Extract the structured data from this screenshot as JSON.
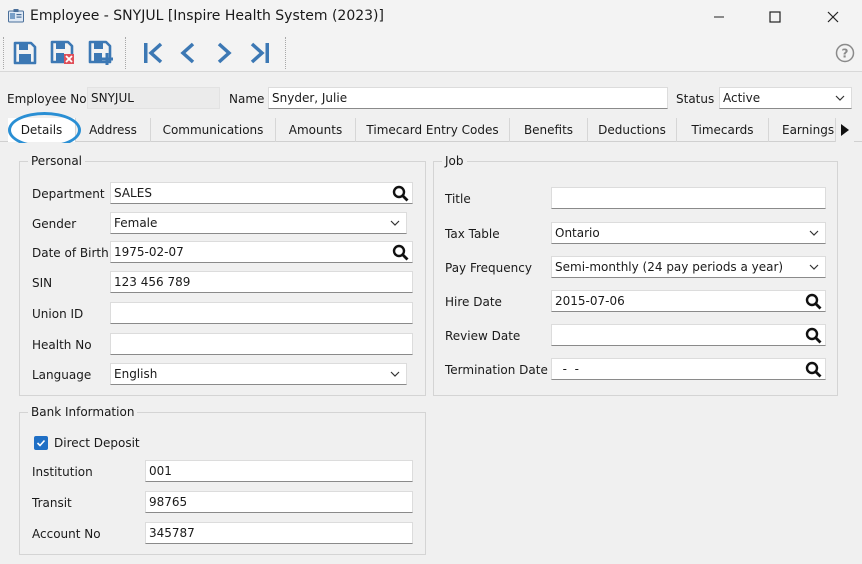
{
  "window": {
    "title": "Employee - SNYJUL [Inspire Health System (2023)]"
  },
  "header": {
    "employee_no_label": "Employee No",
    "employee_no_value": "SNYJUL",
    "name_label": "Name",
    "name_value": "Snyder, Julie",
    "status_label": "Status",
    "status_value": "Active"
  },
  "tabs": [
    {
      "label": "Details",
      "active": true
    },
    {
      "label": "Address"
    },
    {
      "label": "Communications"
    },
    {
      "label": "Amounts"
    },
    {
      "label": "Timecard Entry Codes"
    },
    {
      "label": "Benefits"
    },
    {
      "label": "Deductions"
    },
    {
      "label": "Timecards"
    },
    {
      "label": "Earnings"
    }
  ],
  "personal": {
    "title": "Personal",
    "department_label": "Department",
    "department_value": "SALES",
    "gender_label": "Gender",
    "gender_value": "Female",
    "dob_label": "Date of Birth",
    "dob_value": "1975-02-07",
    "sin_label": "SIN",
    "sin_value": "123 456 789",
    "union_label": "Union ID",
    "union_value": "",
    "health_label": "Health No",
    "health_value": "",
    "language_label": "Language",
    "language_value": "English"
  },
  "job": {
    "title": "Job",
    "title_label": "Title",
    "title_value": "",
    "tax_table_label": "Tax Table",
    "tax_table_value": "Ontario",
    "pay_frequency_label": "Pay Frequency",
    "pay_frequency_value": "Semi-monthly (24 pay periods a year)",
    "hire_date_label": "Hire Date",
    "hire_date_value": "2015-07-06",
    "review_date_label": "Review Date",
    "review_date_value": "  -  -",
    "termination_date_label": "Termination Date",
    "termination_date_value": "  -  -"
  },
  "bank": {
    "title": "Bank Information",
    "direct_deposit_label": "Direct Deposit",
    "direct_deposit_checked": true,
    "institution_label": "Institution",
    "institution_value": "001",
    "transit_label": "Transit",
    "transit_value": "98765",
    "account_label": "Account No",
    "account_value": "345787"
  },
  "icons": {
    "toolbar": [
      "save-icon",
      "save-close-icon",
      "save-new-icon",
      "first-record-icon",
      "previous-record-icon",
      "next-record-icon",
      "last-record-icon",
      "help-icon"
    ],
    "accent": "#3c78b4",
    "highlight": "#2a8fd4"
  }
}
